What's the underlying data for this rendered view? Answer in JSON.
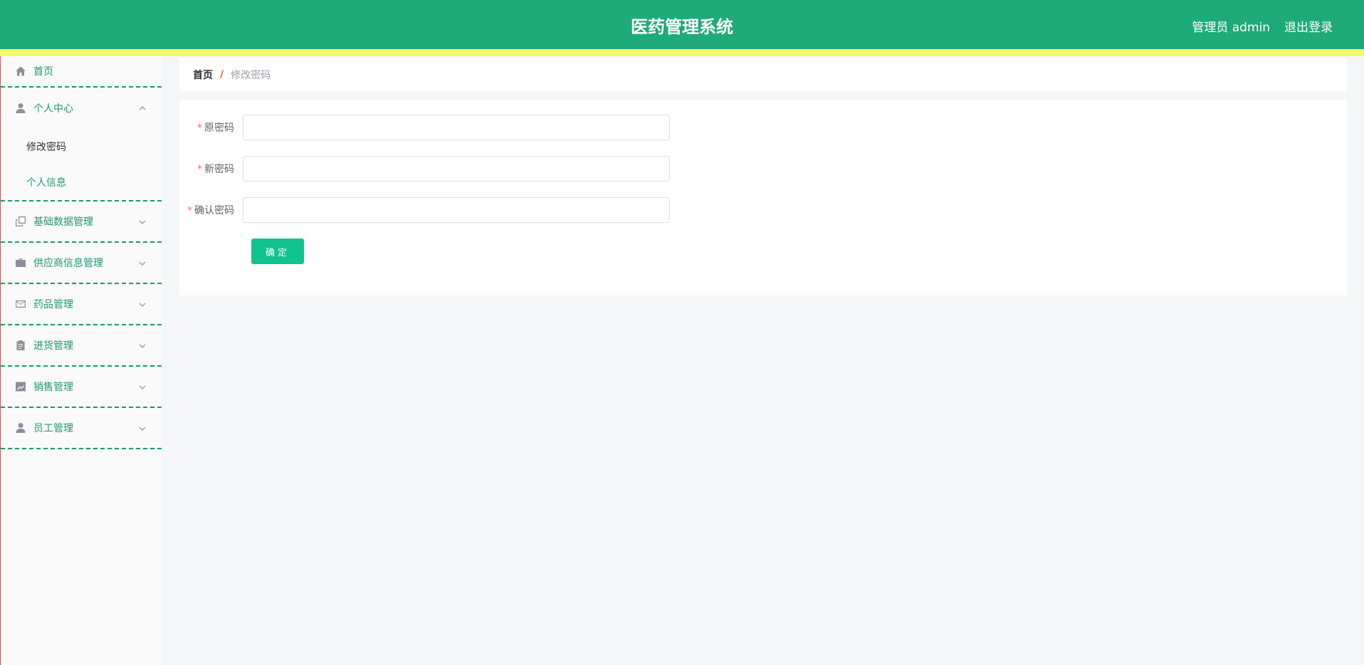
{
  "header": {
    "title": "医药管理系统",
    "user": "管理员 admin",
    "logout": "退出登录"
  },
  "sidebar": {
    "home": "首页",
    "personal_center": {
      "label": "个人中心",
      "items": [
        "修改密码",
        "个人信息"
      ]
    },
    "groups": [
      {
        "label": "基础数据管理",
        "icon": "copy-icon"
      },
      {
        "label": "供应商信息管理",
        "icon": "briefcase-icon"
      },
      {
        "label": "药品管理",
        "icon": "mail-icon"
      },
      {
        "label": "进货管理",
        "icon": "clipboard-icon"
      },
      {
        "label": "销售管理",
        "icon": "chart-icon"
      },
      {
        "label": "员工管理",
        "icon": "user-icon"
      }
    ]
  },
  "breadcrumb": {
    "home": "首页",
    "separator": "/",
    "current": "修改密码"
  },
  "form": {
    "old_password_label": "原密码",
    "new_password_label": "新密码",
    "confirm_password_label": "确认密码",
    "required_mark": "*",
    "old_password_value": "",
    "new_password_value": "",
    "confirm_password_value": "",
    "submit_label": "确定"
  },
  "colors": {
    "header": "#1eaa79",
    "strip": "#f7fb74",
    "accent": "#1a9a6d",
    "button": "#10c38e"
  }
}
